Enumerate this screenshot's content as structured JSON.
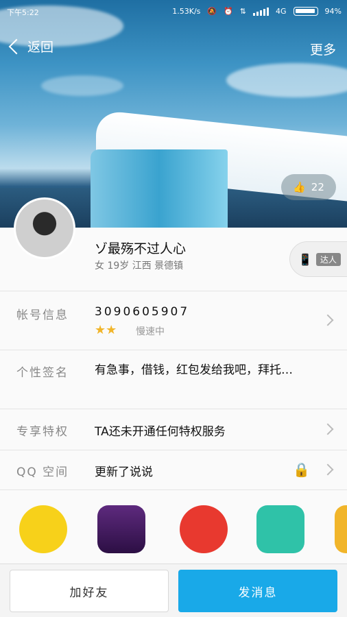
{
  "status_bar": {
    "time": "下午5:22",
    "net_speed": "1.53K/s",
    "network": "4G",
    "battery": "94%"
  },
  "nav": {
    "back_label": "返回",
    "more_label": "更多"
  },
  "likes": {
    "count": "22"
  },
  "profile": {
    "nickname": "ゾ最殇不过人心",
    "meta": "女 19岁 江西 景德镇",
    "badge_label": "达人"
  },
  "rows": {
    "account": {
      "label": "帐号信息",
      "value": "3090605907",
      "level_text": "慢速中"
    },
    "signature": {
      "label": "个性签名",
      "value": "有急事，借钱，红包发给我吧，拜托…"
    },
    "privileges": {
      "label": "专享特权",
      "value": "TA还未开通任何特权服务"
    },
    "qzone": {
      "label": "QQ 空间",
      "value": "更新了说说"
    }
  },
  "bottom": {
    "add_friend": "加好友",
    "send_message": "发消息"
  },
  "colors": {
    "accent": "#19a9e8"
  }
}
